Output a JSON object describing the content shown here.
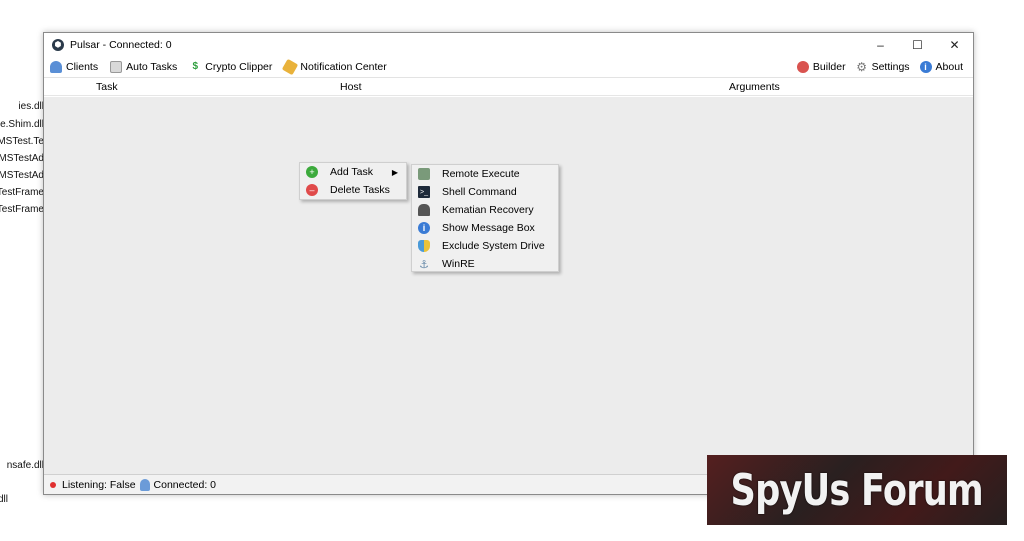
{
  "background_files": [
    "ies.dll",
    "ge.Shim.dll",
    "MSTest.Te",
    "MSTestAd",
    "MSTestAd",
    "TestFrame",
    "TestFrame",
    "nsafe.dll",
    "dll"
  ],
  "window": {
    "title": "Pulsar - Connected: 0",
    "controls": {
      "minimize": "–",
      "maximize": "☐",
      "close": "✕"
    }
  },
  "menu": {
    "left": [
      {
        "label": "Clients",
        "icon": "users-icon"
      },
      {
        "label": "Auto Tasks",
        "icon": "tasks-icon"
      },
      {
        "label": "Crypto Clipper",
        "icon": "dollar-icon"
      },
      {
        "label": "Notification Center",
        "icon": "broom-icon"
      }
    ],
    "right": [
      {
        "label": "Builder",
        "icon": "builder-icon"
      },
      {
        "label": "Settings",
        "icon": "gear-icon"
      },
      {
        "label": "About",
        "icon": "info-icon"
      }
    ]
  },
  "columns": [
    "Task",
    "Host",
    "Arguments"
  ],
  "context_menu": {
    "items": [
      {
        "label": "Add Task",
        "icon": "add-icon",
        "has_submenu": true
      },
      {
        "label": "Delete Tasks",
        "icon": "delete-icon"
      }
    ],
    "submenu": [
      {
        "label": "Remote Execute",
        "icon": "remote-execute-icon"
      },
      {
        "label": "Shell Command",
        "icon": "terminal-icon"
      },
      {
        "label": "Kematian Recovery",
        "icon": "person-icon"
      },
      {
        "label": "Show Message Box",
        "icon": "info-icon"
      },
      {
        "label": "Exclude System Drive",
        "icon": "shield-icon"
      },
      {
        "label": "WinRE",
        "icon": "anchor-icon"
      }
    ]
  },
  "status": {
    "listening": "Listening: False",
    "connected": "Connected: 0"
  },
  "watermark": "SpyUs Forum",
  "colors": {
    "status_dot": "#e03030",
    "add": "#3caa3c",
    "delete": "#e04a4a",
    "info": "#3a7bd5"
  }
}
